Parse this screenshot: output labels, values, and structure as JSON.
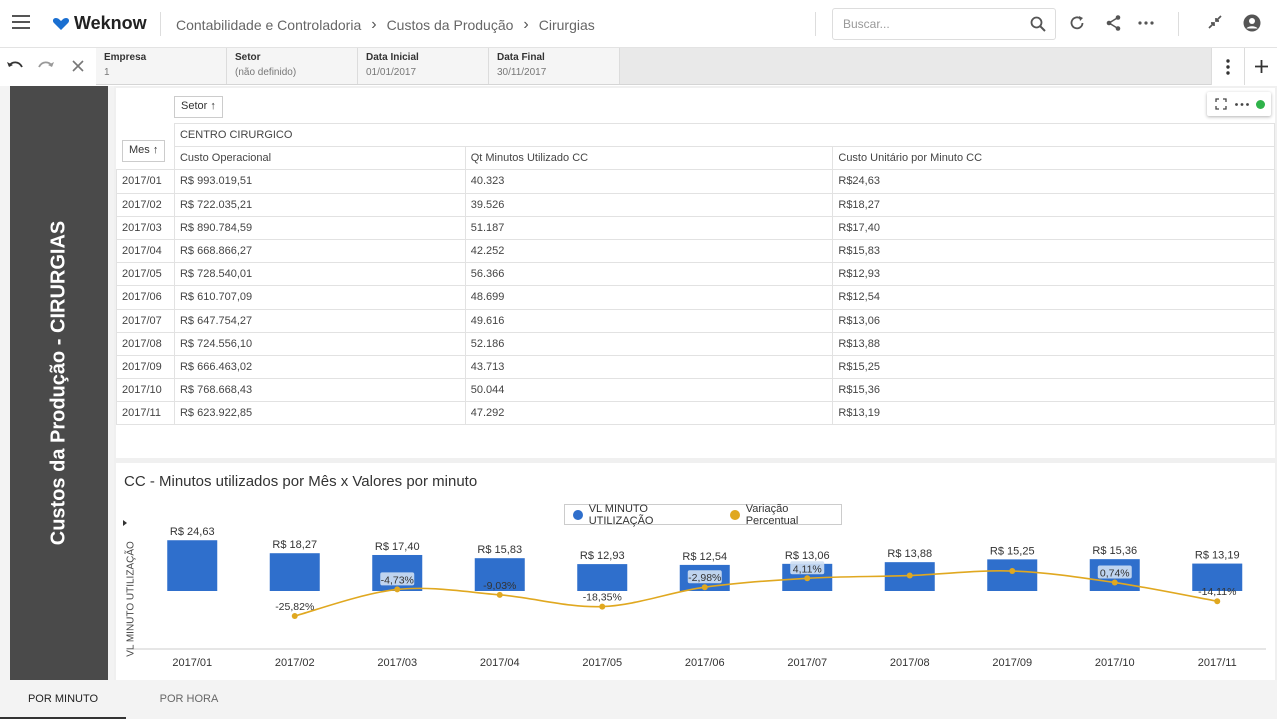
{
  "app": {
    "brand": "Weknow"
  },
  "breadcrumb": [
    "Contabilidade e Controladoria",
    "Custos da Produção",
    "Cirurgias"
  ],
  "search": {
    "placeholder": "Buscar..."
  },
  "filters": [
    {
      "label": "Empresa",
      "value": "1"
    },
    {
      "label": "Setor",
      "value": "(não definido)"
    },
    {
      "label": "Data Inicial",
      "value": "01/01/2017"
    },
    {
      "label": "Data Final",
      "value": "30/11/2017"
    }
  ],
  "page_title": "Custos da Produção - CIRURGIAS",
  "pivot": {
    "col_field": "Setor ↑",
    "row_field": "Mes ↑",
    "group": "CENTRO CIRURGICO",
    "headers": [
      "Custo Operacional",
      "Qt Minutos Utilizado CC",
      "Custo Unitário por Minuto CC"
    ],
    "rows": [
      [
        "2017/01",
        "R$ 993.019,51",
        "40.323",
        "R$24,63"
      ],
      [
        "2017/02",
        "R$ 722.035,21",
        "39.526",
        "R$18,27"
      ],
      [
        "2017/03",
        "R$ 890.784,59",
        "51.187",
        "R$17,40"
      ],
      [
        "2017/04",
        "R$ 668.866,27",
        "42.252",
        "R$15,83"
      ],
      [
        "2017/05",
        "R$ 728.540,01",
        "56.366",
        "R$12,93"
      ],
      [
        "2017/06",
        "R$ 610.707,09",
        "48.699",
        "R$12,54"
      ],
      [
        "2017/07",
        "R$ 647.754,27",
        "49.616",
        "R$13,06"
      ],
      [
        "2017/08",
        "R$ 724.556,10",
        "52.186",
        "R$13,88"
      ],
      [
        "2017/09",
        "R$ 666.463,02",
        "43.713",
        "R$15,25"
      ],
      [
        "2017/10",
        "R$ 768.668,43",
        "50.044",
        "R$15,36"
      ],
      [
        "2017/11",
        "R$ 623.922,85",
        "47.292",
        "R$13,19"
      ]
    ]
  },
  "chart_data": {
    "type": "bar",
    "title": "CC - Minutos utilizados por Mês x Valores por minuto",
    "ylabel": "VL MINUTO UTILIZAÇÃO",
    "categories": [
      "2017/01",
      "2017/02",
      "2017/03",
      "2017/04",
      "2017/05",
      "2017/06",
      "2017/07",
      "2017/08",
      "2017/09",
      "2017/10",
      "2017/11"
    ],
    "series": [
      {
        "name": "VL MINUTO UTILIZAÇÃO",
        "type": "bar",
        "color": "#2f6fcc",
        "values": [
          24.63,
          18.27,
          17.4,
          15.83,
          12.93,
          12.54,
          13.06,
          13.88,
          15.25,
          15.36,
          13.19
        ],
        "labels": [
          "R$ 24,63",
          "R$ 18,27",
          "R$ 17,40",
          "R$ 15,83",
          "R$ 12,93",
          "R$ 12,54",
          "R$ 13,06",
          "R$ 13,88",
          "R$ 15,25",
          "R$ 15,36",
          "R$ 13,19"
        ]
      },
      {
        "name": "Variação Percentual",
        "type": "line",
        "color": "#e0a820",
        "values": [
          null,
          -25.82,
          -4.73,
          -9.03,
          -18.35,
          -2.98,
          4.11,
          6.28,
          9.87,
          0.74,
          -14.11
        ],
        "labels": [
          "",
          "-25,82%",
          "-4,73%",
          "-9,03%",
          "-18,35%",
          "-2,98%",
          "4,11%",
          "",
          "",
          "0,74%",
          "-14,11%"
        ]
      }
    ],
    "legend": "top-center"
  },
  "tabs": [
    {
      "label": "POR MINUTO",
      "active": true
    },
    {
      "label": "POR HORA",
      "active": false
    }
  ]
}
